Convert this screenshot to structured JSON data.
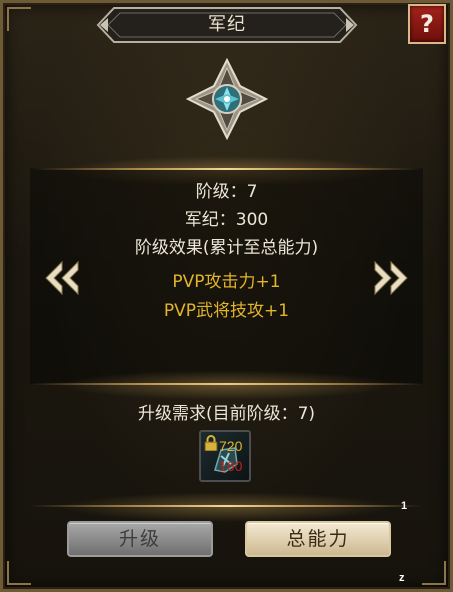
{
  "window": {
    "title": "军纪",
    "help_label": "?"
  },
  "info": {
    "rank_line": "阶级：7",
    "discipline_line": "军纪：300",
    "effect_header": "阶级效果(累计至总能力)",
    "effects": [
      "PVP攻击力+1",
      "PVP武将技攻+1"
    ]
  },
  "requirement": {
    "header": "升级需求(目前阶级：7)",
    "item": {
      "icon": "rune-stone-icon",
      "count_top": "720",
      "count_bottom": "160"
    }
  },
  "buttons": {
    "upgrade_label": "升级",
    "total_label": "总能力"
  },
  "overlay": {
    "corner_num_top": "1",
    "corner_num_bottom": "z"
  },
  "colors": {
    "gold_text": "#e3b52a",
    "red_text": "#c0221a",
    "frame": "#6e5a36"
  }
}
